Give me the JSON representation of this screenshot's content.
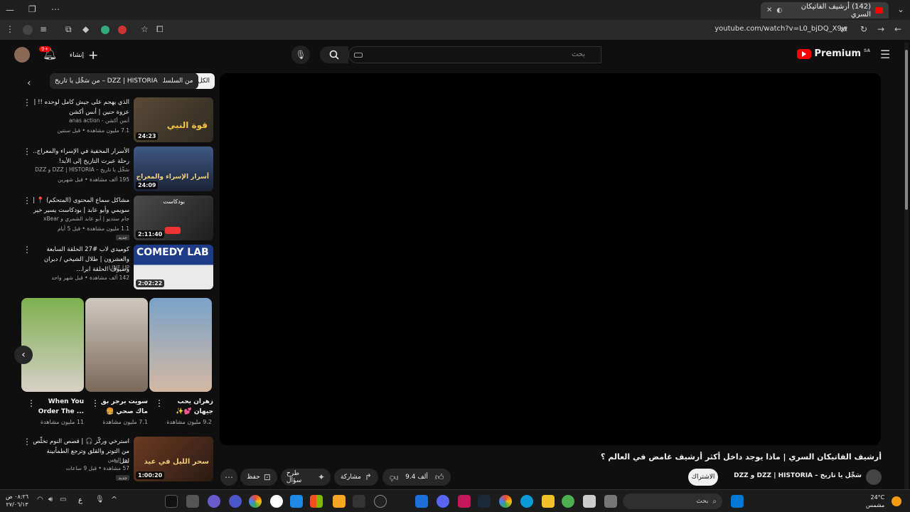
{
  "browser": {
    "tab_title": "(142) أرشيف الفاتيكان السري",
    "url": "youtube.com/watch?v=L0_bjDQ_X9w"
  },
  "header": {
    "logo": "Premium",
    "country": "SA",
    "search_placeholder": "بحث",
    "create_label": "إنشاء",
    "notif_count": "9+"
  },
  "chips": [
    "الكل",
    "من السلسلة",
    "من سَجِّل يا تاريخ – DZZ | HISTORIA"
  ],
  "video": {
    "title": "أرشيف الفاتيكان السري | ماذا يوجد داخل أكثر أرشيف غامض في العالم ؟",
    "channel": "سَجِّل يا تاريخ – DZZ | HISTORIA و DZZ",
    "subscribe": "الاشتراك",
    "likes": "9.4 ألف",
    "share": "مشاركة",
    "ask": "طرح سؤال",
    "save": "حفظ"
  },
  "recs": [
    {
      "title": "الذي يهجم على جيش كامل لوحده !! | عزوة حنين | أنس أكشن",
      "channel": "أنس أكشن - anas action",
      "stats": "7.1 مليون مشاهدة • قبل سنتين",
      "duration": "24:23",
      "thumb_text": "قوة النبي"
    },
    {
      "title": "الأسرار المخفية في الإسراء والمعراج.. رحلة عبرت التاريخ إلى الأبد!",
      "channel": "سَجِّل يا تاريخ – DZZ | HISTORIA و DZZ",
      "stats": "195 ألف مشاهدة • قبل شهرين",
      "duration": "24:09",
      "thumb_text": "أسرار الإسراء والمعراج"
    },
    {
      "title": "مشاكل سماع المحتوى (المتحكم) 📍 | سويمي وأبو عابد | بودكاست يسير خير",
      "channel": "جام ستديو | أبو عابد الشمري و xBear",
      "stats": "1.1 مليون مشاهدة • قبل 5 أيام",
      "badge": "جديد",
      "duration": "2:11:40",
      "thumb_text": "بودكاست"
    },
    {
      "title": "كوميدي لاب #27 الحلقة السابعة والعشرون | طلال الشيخي / دبران وضيوف الحلقة ابرا...",
      "channel": "LINE UP",
      "stats": "142 ألف مشاهدة • قبل شهر واحد",
      "duration": "2:02:22",
      "thumb_text": "COMEDY LAB"
    }
  ],
  "shorts": [
    {
      "title": "زهران يحب جيهان 💕✨",
      "views": "9.2 مليون مشاهدة"
    },
    {
      "title": "سويت برجر بق ماك صحي 🍔",
      "views": "7.1 مليون مشاهدة"
    },
    {
      "title": "When You Order The ...",
      "views": "11 مليون مشاهدة"
    }
  ],
  "rec5": {
    "title": "استرخي وركّز 🎧 | قصص النوم تخلّص من التوتر والقلق وترجع الطمأنينة لقل...",
    "channel": "نور اليقين",
    "stats": "57 مشاهدة • قبل 9 ساعات",
    "badge": "جديد",
    "duration": "1:00:20",
    "thumb_text": "سحر الليل في عيد"
  },
  "taskbar": {
    "weather_temp": "24°C",
    "weather_desc": "مشمس",
    "time": "٠٨:٢٦ ص",
    "date": "٢٧/٠٦/١٣",
    "lang": "ع",
    "search_label": "بحث"
  },
  "colors": {
    "bg": "#0f0f0f",
    "accent": "#ff0000"
  }
}
